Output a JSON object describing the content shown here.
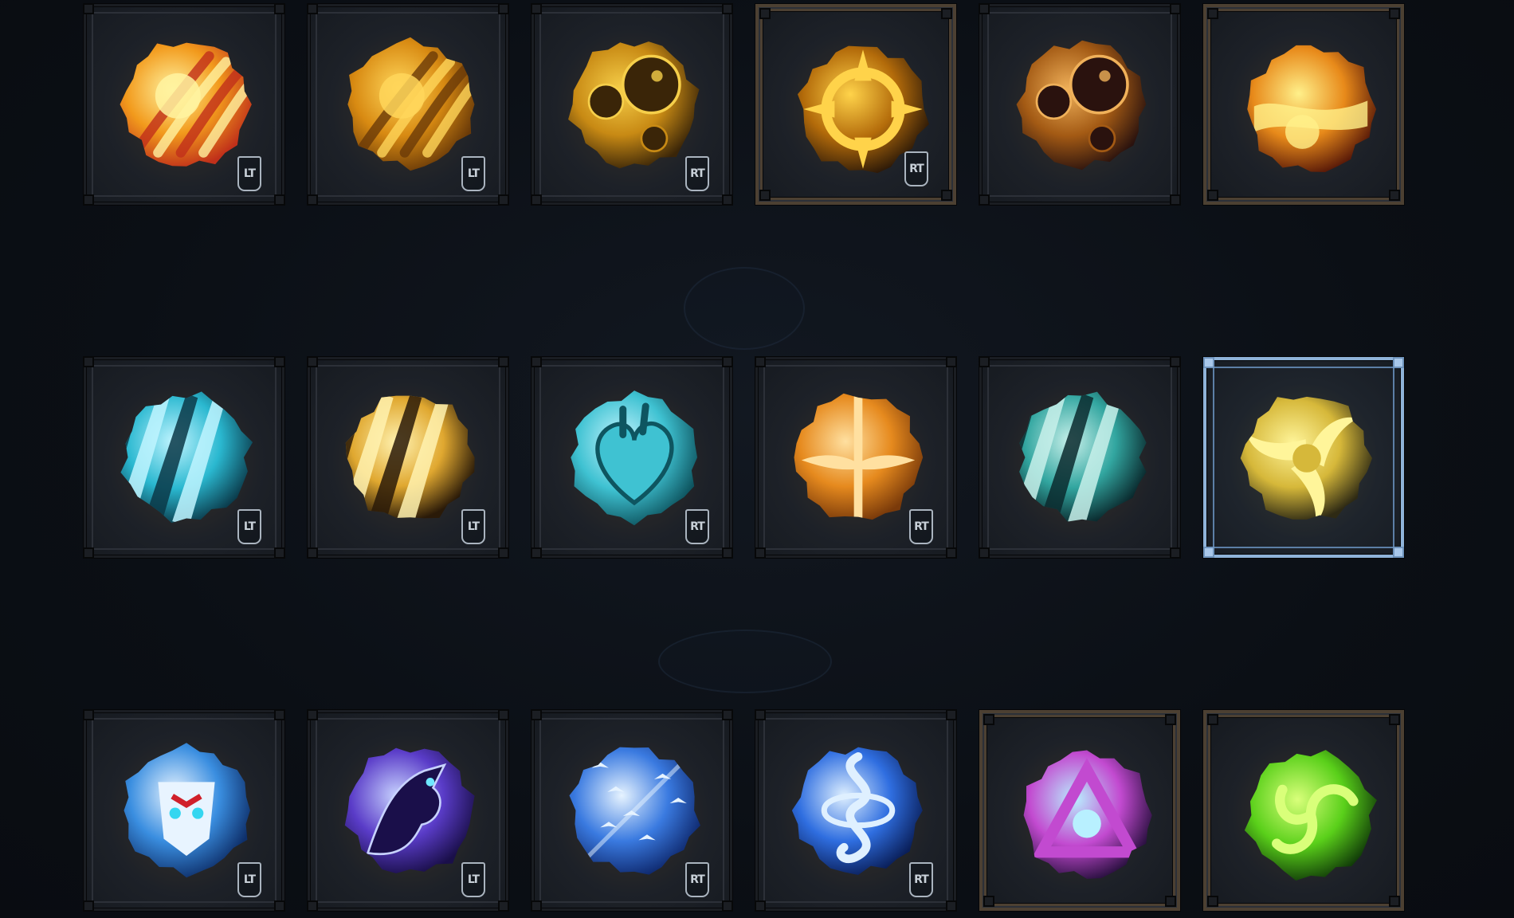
{
  "grid": {
    "rows": [
      [
        {
          "name": "fire-meteor-icon",
          "badge": "LT",
          "frame": "normal",
          "colors": [
            "#fff3a0",
            "#f29a1c",
            "#c0301a"
          ]
        },
        {
          "name": "golden-streaks-icon",
          "badge": "LT",
          "frame": "normal",
          "colors": [
            "#ffd65a",
            "#d88a12",
            "#6a3a08"
          ]
        },
        {
          "name": "bubbles-orb-icon",
          "badge": "RT",
          "frame": "normal",
          "colors": [
            "#f6cf4a",
            "#c88a14",
            "#3a2508"
          ]
        },
        {
          "name": "target-crosshair-icon",
          "badge": "RT",
          "frame": "gold",
          "colors": [
            "#ffd34a",
            "#b36b0a",
            "#2e1a08"
          ]
        },
        {
          "name": "dark-bubbles-icon",
          "badge": "",
          "frame": "normal",
          "colors": [
            "#f0b15a",
            "#a35a14",
            "#2a120e"
          ]
        },
        {
          "name": "lava-rock-icon",
          "badge": "",
          "frame": "gold",
          "colors": [
            "#fff08a",
            "#e88a1a",
            "#5a1a08"
          ]
        }
      ],
      [
        {
          "name": "cyan-claw-slash-icon",
          "badge": "LT",
          "frame": "normal",
          "colors": [
            "#bff4ff",
            "#2ab8d0",
            "#0a3848"
          ]
        },
        {
          "name": "gold-claw-slash-icon",
          "badge": "LT",
          "frame": "normal",
          "colors": [
            "#fff2b0",
            "#e0a830",
            "#2a1a08"
          ]
        },
        {
          "name": "crystal-heart-icon",
          "badge": "RT",
          "frame": "normal",
          "colors": [
            "#c9f6ff",
            "#3fc2d2",
            "#0e5560"
          ]
        },
        {
          "name": "winged-sword-icon",
          "badge": "RT",
          "frame": "normal",
          "colors": [
            "#ffe0a0",
            "#e68a1e",
            "#7a3a0a"
          ]
        },
        {
          "name": "teal-claw-slash-icon",
          "badge": "",
          "frame": "normal",
          "colors": [
            "#c8f0ea",
            "#32a6a0",
            "#0a2a2e"
          ]
        },
        {
          "name": "golden-pinwheel-icon",
          "badge": "",
          "frame": "selected",
          "colors": [
            "#fff59a",
            "#d6b83a",
            "#2e2a14"
          ]
        }
      ],
      [
        {
          "name": "white-beast-mask-icon",
          "badge": "LT",
          "frame": "normal",
          "colors": [
            "#e8f4ff",
            "#3a8ee0",
            "#0e2f6a"
          ]
        },
        {
          "name": "shadow-wolf-icon",
          "badge": "LT",
          "frame": "normal",
          "colors": [
            "#c7d2ff",
            "#5a3cc8",
            "#1a0f4a"
          ]
        },
        {
          "name": "bird-flock-icon",
          "badge": "RT",
          "frame": "normal",
          "colors": [
            "#e6f3ff",
            "#3a7ae0",
            "#0f2a70"
          ]
        },
        {
          "name": "serpent-knot-icon",
          "badge": "RT",
          "frame": "normal",
          "colors": [
            "#dff0ff",
            "#2f6ee0",
            "#0a1f5a"
          ]
        },
        {
          "name": "arcane-triangle-icon",
          "badge": "",
          "frame": "gold",
          "colors": [
            "#b8f0ff",
            "#c24ad0",
            "#2a1040"
          ]
        },
        {
          "name": "green-swirl-icon",
          "badge": "",
          "frame": "gold",
          "colors": [
            "#d9ff7a",
            "#5ad01a",
            "#103a08"
          ]
        }
      ]
    ]
  }
}
